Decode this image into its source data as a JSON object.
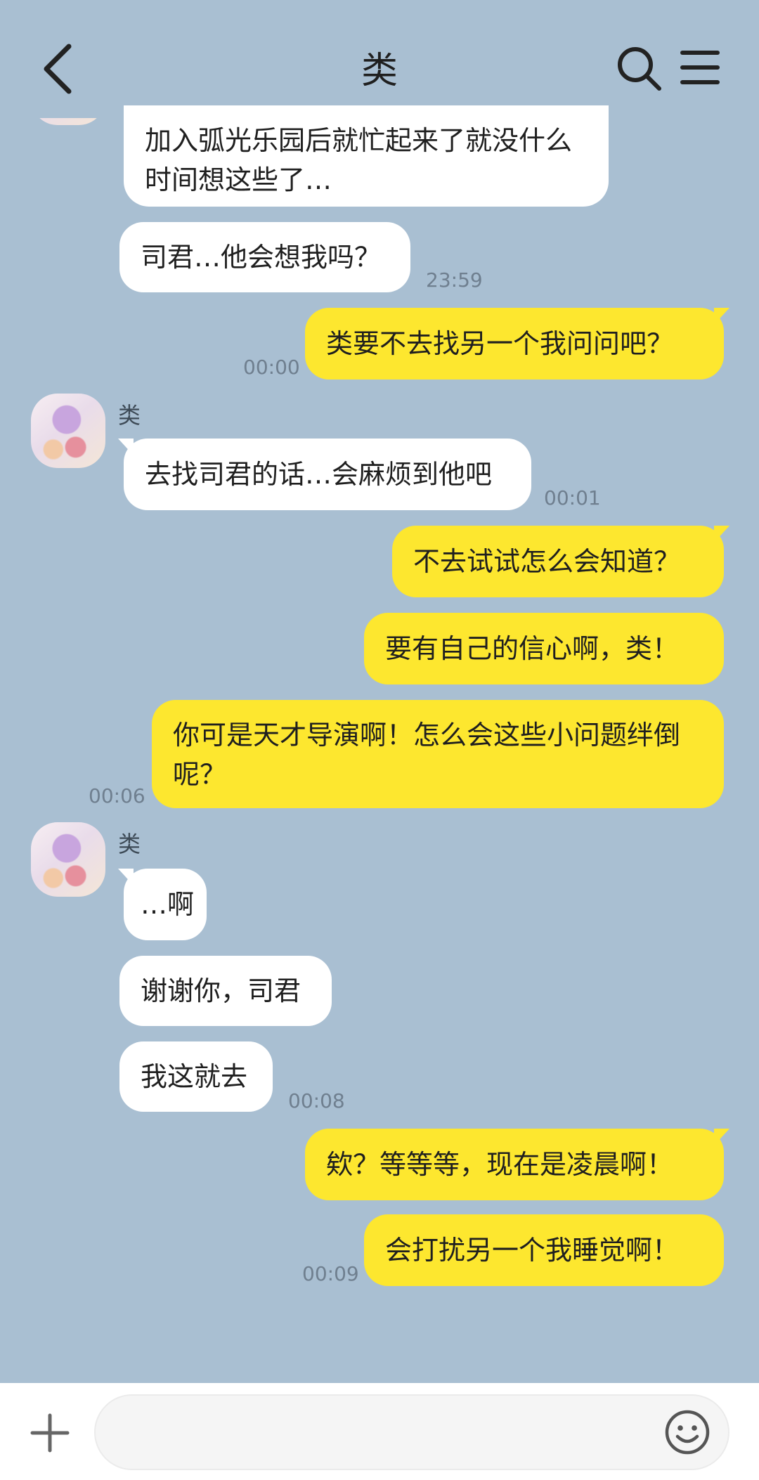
{
  "header": {
    "title": "类"
  },
  "messages": [
    {
      "text": "加入弧光乐园后就忙起来了就没什么时间想这些了…"
    },
    {
      "text": "司君…他会想我吗？",
      "time": "23:59"
    },
    {
      "text": "类要不去找另一个我问问吧？",
      "time": "00:00"
    },
    {
      "sender": "类",
      "text": "去找司君的话…会麻烦到他吧",
      "time": "00:01"
    },
    {
      "text": "不去试试怎么会知道？"
    },
    {
      "text": "要有自己的信心啊，类！"
    },
    {
      "text": "你可是天才导演啊！怎么会这些小问题绊倒呢？",
      "time": "00:06"
    },
    {
      "sender": "类",
      "text": "…啊"
    },
    {
      "text": "谢谢你，司君"
    },
    {
      "text": "我这就去",
      "time": "00:08"
    },
    {
      "text": "欸？等等等，现在是凌晨啊！"
    },
    {
      "text": "会打扰另一个我睡觉啊！",
      "time": "00:09"
    }
  ],
  "composer": {
    "text": ""
  },
  "icons": {
    "back": "chevron-left-icon",
    "search": "search-icon",
    "menu": "hamburger-menu-icon",
    "add": "plus-icon",
    "emoji": "smiley-icon"
  },
  "colors": {
    "background": "#a9bfd2",
    "incoming_bubble": "#ffffff",
    "outgoing_bubble": "#fde72f"
  }
}
